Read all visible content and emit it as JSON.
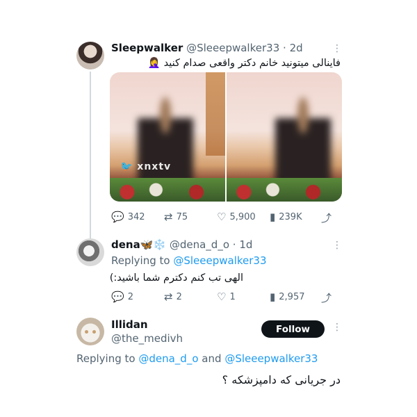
{
  "tweet1": {
    "name": "Sleepwalker",
    "handle": "@Sleeepwalker33",
    "time": "· 2d",
    "text": "فاینالی میتونید خانم دکتر واقعی صدام کنید 🤦‍♀️",
    "watermark": "🐦 xnxtv",
    "stats": {
      "replies": "342",
      "retweets": "75",
      "likes": "5,900",
      "views": "239K"
    }
  },
  "tweet2": {
    "name": "dena🦋❄️",
    "handle": "@dena_d_o",
    "time": "· 1d",
    "replying_prefix": "Replying to",
    "replying_to": "@Sleeepwalker33",
    "text": "الهی تب کنم دکترم شما باشید:)",
    "stats": {
      "replies": "2",
      "retweets": "2",
      "likes": "1",
      "views": "2,957"
    }
  },
  "tweet3": {
    "name": "Illidan",
    "handle": "@the_medivh",
    "follow_label": "Follow",
    "replying_prefix": "Replying to",
    "replying_mention1": "@dena_d_o",
    "replying_and": "and",
    "replying_mention2": "@Sleeepwalker33",
    "text": "در جریانی که دامپزشکه ؟"
  },
  "icons": {
    "more": "more-dots-icon",
    "reply": "reply-icon",
    "retweet": "retweet-icon",
    "like": "heart-icon",
    "views": "views-bars-icon",
    "share": "share-icon"
  },
  "colors": {
    "accent": "#1d9bf0",
    "text": "#0f1419",
    "muted": "#536471",
    "follow_bg": "#0f1419"
  }
}
